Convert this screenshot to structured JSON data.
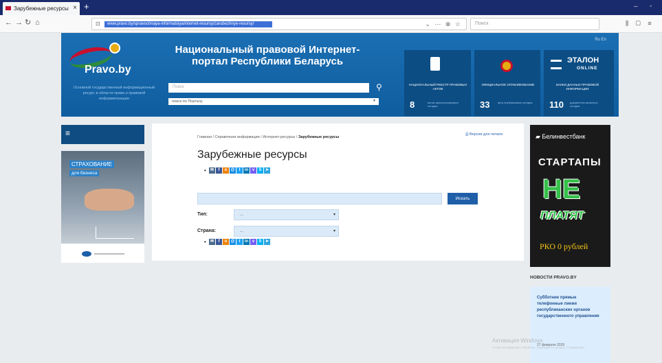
{
  "browser": {
    "tab_title": "Зарубежные ресурсы",
    "url": "www.pravo.by/spravochnaya-informatsiya/internet-resursy/zarubezhnye-resursy/",
    "search_placeholder": "Поиск"
  },
  "header": {
    "logo_text": "Pravo.by",
    "logo_desc": "Основной государственный информационный ресурс в области права и правовой информатизации",
    "title": "Национальный правовой Интернет-портал Республики Беларусь",
    "search_placeholder": "Поиск",
    "search_scope": "поиск по Порталу",
    "lang": "Ru  En",
    "tiles": [
      {
        "label": "НАЦИОНАЛЬНЫЙ РЕЕСТР ПРАВОВЫХ АКТОВ",
        "count": "8",
        "note": "актов зарегистрировано сегодня"
      },
      {
        "label": "ОФИЦИАЛЬНОЕ ОПУБЛИКОВАНИЕ",
        "count": "33",
        "note": "акта опубликовано сегодня"
      },
      {
        "label": "БАНКИ ДАННЫХ ПРАВОВОЙ ИНФОРМАЦИИ",
        "count": "110",
        "note": "документов включено сегодня",
        "brand": "ЭТАЛОН",
        "brand_sub": "ONLINE"
      }
    ]
  },
  "left": {
    "menu_icon": "≡",
    "banner_line1": "СТРАХОВАНИЕ",
    "banner_line2": "для бизнеса"
  },
  "main": {
    "breadcrumb_prefix": "Главная / Справочная информация / Интернет-ресурсы / ",
    "breadcrumb_current": "Зарубежные ресурсы",
    "print_link": "Версия для печати",
    "title": "Зарубежные ресурсы",
    "search_button": "Искать",
    "type_label": "Тип:",
    "type_value": "...",
    "country_label": "Страна:",
    "country_value": "...",
    "share_icons": [
      {
        "name": "email-share-icon",
        "glyph": "✉",
        "color": "#4a6a8a"
      },
      {
        "name": "facebook-share-icon",
        "glyph": "f",
        "color": "#3b5998"
      },
      {
        "name": "odnoklassniki-share-icon",
        "glyph": "o",
        "color": "#ee8208"
      },
      {
        "name": "mailru-share-icon",
        "glyph": "@",
        "color": "#168de2"
      },
      {
        "name": "twitter-share-icon",
        "glyph": "t",
        "color": "#1da1f2"
      },
      {
        "name": "linkedin-share-icon",
        "glyph": "in",
        "color": "#0077b5"
      },
      {
        "name": "viber-share-icon",
        "glyph": "v",
        "color": "#7360f2"
      },
      {
        "name": "skype-share-icon",
        "glyph": "S",
        "color": "#00aff0"
      },
      {
        "name": "telegram-share-icon",
        "glyph": "➤",
        "color": "#2ca5e0"
      }
    ]
  },
  "ad": {
    "brand": "Белинвестбанк",
    "line1": "СТАРТАПЫ",
    "line2": "НЕ",
    "line3": "ПЛАТЯТ",
    "line4": "РКО 0 рублей"
  },
  "news": {
    "heading": "НОВОСТИ PRAVO.BY",
    "item": "Субботние прямые телефонные линии республиканских органов государственного управления",
    "date": "27 февраля 2019"
  },
  "watermark": {
    "line1": "Активация Windows",
    "line2": "Чтобы активировать Windows, перейдите в раздел \"Параметры\"."
  }
}
